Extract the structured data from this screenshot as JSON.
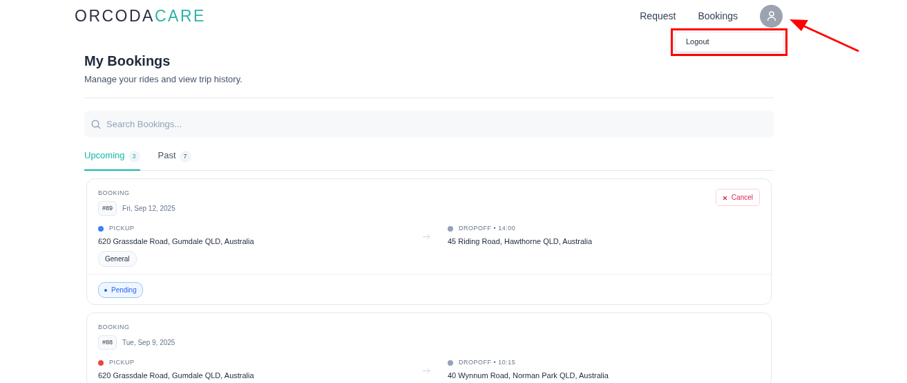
{
  "logo": {
    "part_1": "ORCODA",
    "part_2": "CARE"
  },
  "nav": [
    {
      "label": "Request"
    },
    {
      "label": "Bookings"
    }
  ],
  "user_menu": {
    "open": true,
    "items": [
      "Logout"
    ]
  },
  "page": {
    "title": "My Bookings",
    "subtitle": "Manage your rides and view trip history."
  },
  "search": {
    "placeholder": "Search Bookings..."
  },
  "tabs": [
    {
      "label": "Upcoming",
      "count": "3",
      "selected": true
    },
    {
      "label": "Past",
      "count": "7",
      "selected": false
    }
  ],
  "bookings": [
    {
      "label": "BOOKING",
      "id": "#89",
      "date": "Fri, Sep 12, 2025",
      "cancel": "Cancel",
      "pickup": {
        "label": "PICKUP",
        "color": "#3b82f6",
        "address": "620 Grassdale Road, Gumdale QLD, Australia"
      },
      "dropoff": {
        "label": "DROPOFF • 14:00",
        "color": "#94a3b8",
        "address": "45 Riding Road, Hawthorne QLD, Australia"
      },
      "tags": [
        "General"
      ],
      "status": "Pending"
    },
    {
      "label": "BOOKING",
      "id": "#88",
      "date": "Tue, Sep 9, 2025",
      "pickup": {
        "label": "PICKUP",
        "color": "#ef4444",
        "address": "620 Grassdale Road, Gumdale QLD, Australia"
      },
      "dropoff": {
        "label": "DROPOFF • 10:15",
        "color": "#94a3b8",
        "address": "40 Wynnum Road, Norman Park QLD, Australia"
      }
    }
  ]
}
